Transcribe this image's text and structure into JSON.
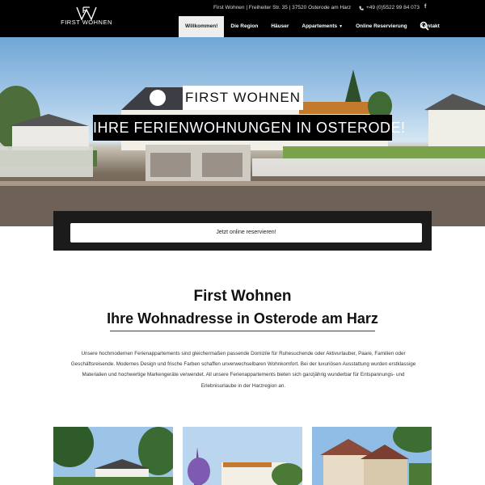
{
  "topbar": {
    "address": "First Wohnen | Freiheiter Str. 35 | 37520 Osterode am Harz",
    "phone": "+49 (0)5522 99 84 073",
    "facebook_icon": "facebook-icon",
    "phone_icon": "phone-icon"
  },
  "logo": {
    "text": "FIRST WOHNEN"
  },
  "nav": {
    "items": [
      "Willkommen!",
      "Die Region",
      "Häuser",
      "Appartements",
      "Online Reservierung",
      "Kontakt"
    ],
    "active": "Willkommen!",
    "search_icon": "search-icon"
  },
  "hero": {
    "title": "FIRST WOHNEN",
    "subtitle": "IHRE FERIENWOHNUNGEN IN OSTERODE!"
  },
  "reservation": {
    "button_label": "Jetzt online reservieren!"
  },
  "intro": {
    "heading": "First Wohnen",
    "subheading": "Ihre Wohnadresse in Osterode am Harz",
    "paragraph": "Unsere hochmodernen Ferienappartements sind gleichermaßen passende Domizile für Ruhesuchende oder Aktivurlauber, Paare, Familien oder Geschäftsreisende. Modernes Design und frische Farben schaffen unverwechselbaren Wohnkomfort. Bei der luxuriösen Ausstattung wurden erstklassige Materialien und hochwertige Markengeräte verwendet. All unsere Ferienappartements bieten sich ganzjährig wunderbar für Entspannungs- und Erlebnisurlaube in der Harzregion an."
  },
  "colors": {
    "header_bg": "#000000",
    "active_nav_bg": "#eeeeee",
    "reservation_bg": "#1b1b1b"
  }
}
